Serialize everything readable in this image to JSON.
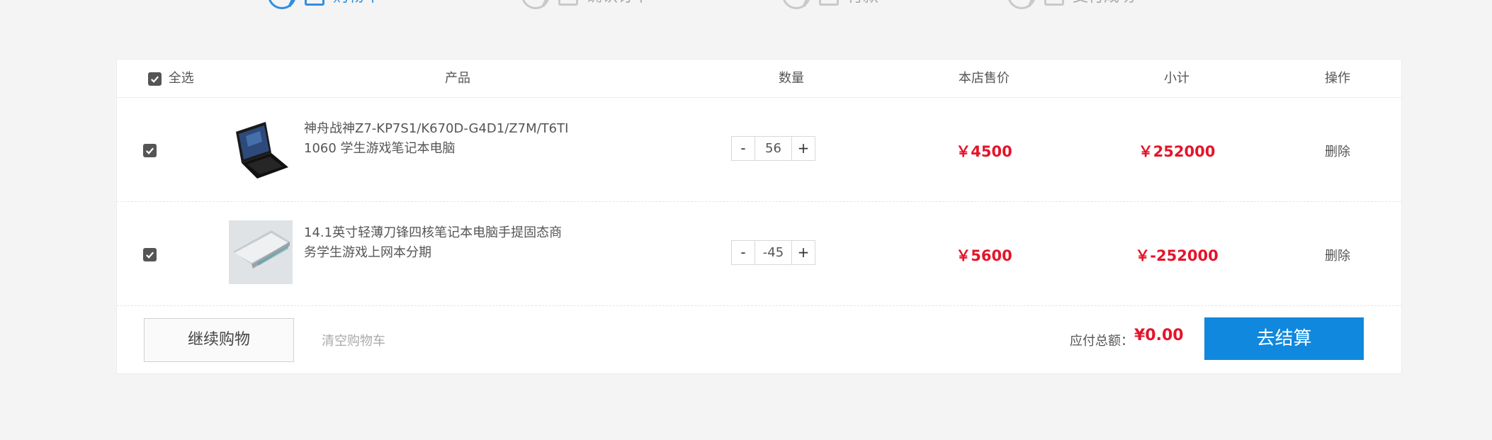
{
  "steps": [
    {
      "label": "购物车",
      "active": true,
      "icon": "cart-icon"
    },
    {
      "label": "确认订单",
      "active": false,
      "icon": "document-icon"
    },
    {
      "label": "付款",
      "active": false,
      "icon": "card-icon"
    },
    {
      "label": "支付成功",
      "active": false,
      "icon": "document-icon"
    }
  ],
  "table": {
    "select_all_label": "全选",
    "headers": {
      "product": "产品",
      "quantity": "数量",
      "price": "本店售价",
      "subtotal": "小计",
      "actions": "操作"
    }
  },
  "items": [
    {
      "checked": true,
      "name": "神舟战神Z7-KP7S1/K670D-G4D1/Z7M/T6TI 1060 学生游戏笔记本电脑",
      "quantity": "56",
      "minus": "-",
      "plus": "+",
      "price": "￥4500",
      "subtotal": "￥252000",
      "delete_label": "删除",
      "thumb_icon": "laptop-gaming-thumbnail"
    },
    {
      "checked": true,
      "name": "14.1英寸轻薄刀锋四核笔记本电脑手提固态商务学生游戏上网本分期",
      "quantity": "-45",
      "minus": "-",
      "plus": "+",
      "price": "￥5600",
      "subtotal": "￥-252000",
      "delete_label": "删除",
      "thumb_icon": "laptop-silver-thumbnail"
    }
  ],
  "footer": {
    "continue_label": "继续购物",
    "clear_label": "清空购物车",
    "total_label": "应付总额：",
    "total_value": "¥0.00",
    "checkout_label": "去结算"
  },
  "colors": {
    "accent": "#0f88de",
    "price": "#e4142a",
    "background": "#f4f4f4"
  }
}
